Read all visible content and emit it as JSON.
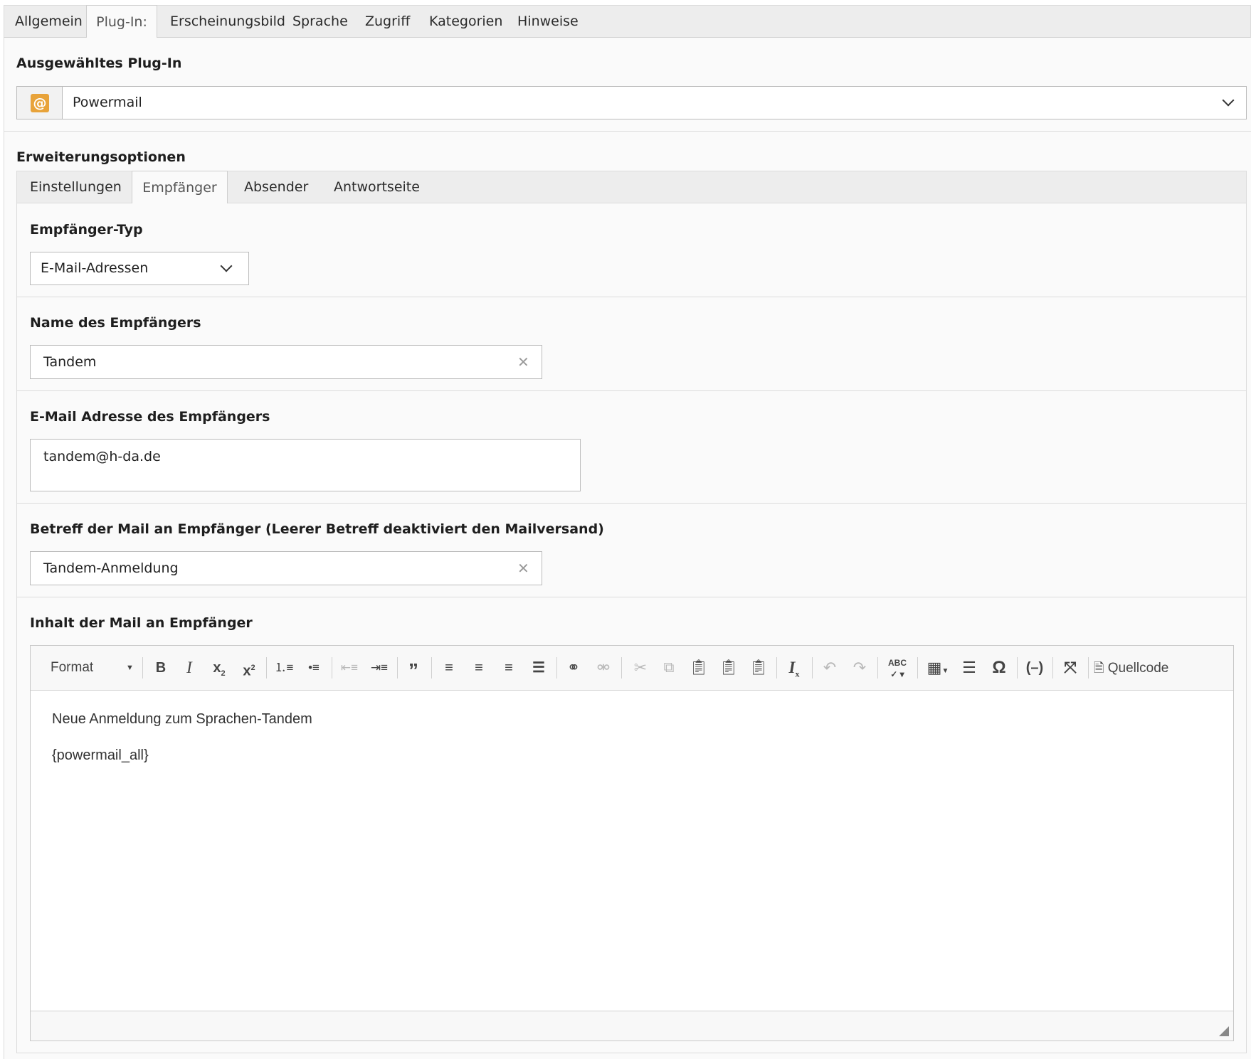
{
  "main_tabs": [
    {
      "label": "Allgemein",
      "active": false
    },
    {
      "label": "Plug-In:",
      "active": true
    },
    {
      "label": "Erscheinungsbild",
      "active": false
    },
    {
      "label": "Sprache",
      "active": false
    },
    {
      "label": "Zugriff",
      "active": false
    },
    {
      "label": "Kategorien",
      "active": false
    },
    {
      "label": "Hinweise",
      "active": false
    }
  ],
  "plugin": {
    "section_label": "Ausgewähltes Plug-In",
    "selected": "Powermail",
    "icon": "at-sign-icon",
    "icon_color": "#e8a33a"
  },
  "extension": {
    "section_label": "Erweiterungsoptionen",
    "tabs": [
      {
        "label": "Einstellungen",
        "active": false
      },
      {
        "label": "Empfänger",
        "active": true
      },
      {
        "label": "Absender",
        "active": false
      },
      {
        "label": "Antwortseite",
        "active": false
      }
    ]
  },
  "fields": {
    "receiver_type": {
      "label": "Empfänger-Typ",
      "value": "E-Mail-Adressen"
    },
    "receiver_name": {
      "label": "Name des Empfängers",
      "value": "Tandem"
    },
    "receiver_email": {
      "label": "E-Mail Adresse des Empfängers",
      "value": "tandem@h-da.de"
    },
    "subject": {
      "label": "Betreff der Mail an Empfänger (Leerer Betreff deaktiviert den Mailversand)",
      "value": "Tandem-Anmeldung"
    },
    "body": {
      "label": "Inhalt der Mail an Empfänger"
    }
  },
  "editor": {
    "format_label": "Format",
    "source_label": "Quellcode",
    "content_lines": [
      "Neue Anmeldung zum Sprachen-Tandem",
      "{powermail_all}"
    ]
  }
}
